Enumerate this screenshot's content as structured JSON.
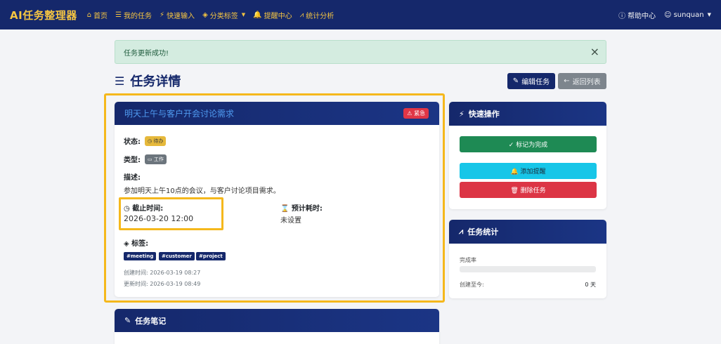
{
  "navbar": {
    "brand": "AI任务整理器",
    "items": [
      {
        "icon": "home-icon",
        "glyph": "⌂",
        "label": "首页"
      },
      {
        "icon": "list-icon",
        "glyph": "☰",
        "label": "我的任务"
      },
      {
        "icon": "lightning-icon",
        "glyph": "⚡",
        "label": "快速输入"
      },
      {
        "icon": "tag-icon",
        "glyph": "◈",
        "label": "分类标签"
      },
      {
        "icon": "bell-icon",
        "glyph": "🔔",
        "label": "提醒中心"
      },
      {
        "icon": "chart-icon",
        "glyph": "⩘",
        "label": "统计分析"
      }
    ],
    "help": {
      "glyph": "ⓘ",
      "label": "帮助中心"
    },
    "user": {
      "glyph": "☺",
      "label": "sunquan"
    }
  },
  "alert": {
    "text": "任务更新成功!",
    "close": "×"
  },
  "page": {
    "title_icon": "☰",
    "title": "任务详情",
    "edit_button": "编辑任务",
    "edit_glyph": "✎",
    "back_button": "返回列表",
    "back_glyph": "←"
  },
  "task": {
    "title": "明天上午与客户开会讨论需求",
    "priority": "⚠ 紧急",
    "status_label": "状态:",
    "status_value": "◷ 待办",
    "type_label": "类型:",
    "type_value": "▭ 工作",
    "description_label": "描述:",
    "description": "参加明天上午10点的会议，与客户讨论项目需求。",
    "deadline_label": "◷ 截止时间:",
    "deadline": "2026-03-20 12:00",
    "estimate_label": "⌛ 预计耗时:",
    "estimate": "未设置",
    "tags_label": "◈ 标签:",
    "tags": [
      "#meeting",
      "#customer",
      "#project"
    ],
    "created": "创建时间: 2026-03-19 08:27",
    "updated": "更新时间: 2026-03-19 08:49"
  },
  "quick": {
    "title": "快速操作",
    "title_glyph": "⚡",
    "done": "✓ 标记为完成",
    "remind": "🔔 添加提醒",
    "delete": "🗑 删除任务"
  },
  "stats": {
    "title": "任务统计",
    "title_glyph": "⩘",
    "completion_label": "完成率",
    "completion_fraction": 0,
    "days_label": "创建至今:",
    "days_value": "0 天"
  },
  "notes": {
    "title": "任务笔记",
    "title_glyph": "✎"
  },
  "colors": {
    "navy": "#15286b",
    "gold": "#f5c542",
    "highlight": "#f5b81c",
    "success": "#1e8a54",
    "info": "#17c6e8",
    "danger": "#dc3545"
  }
}
